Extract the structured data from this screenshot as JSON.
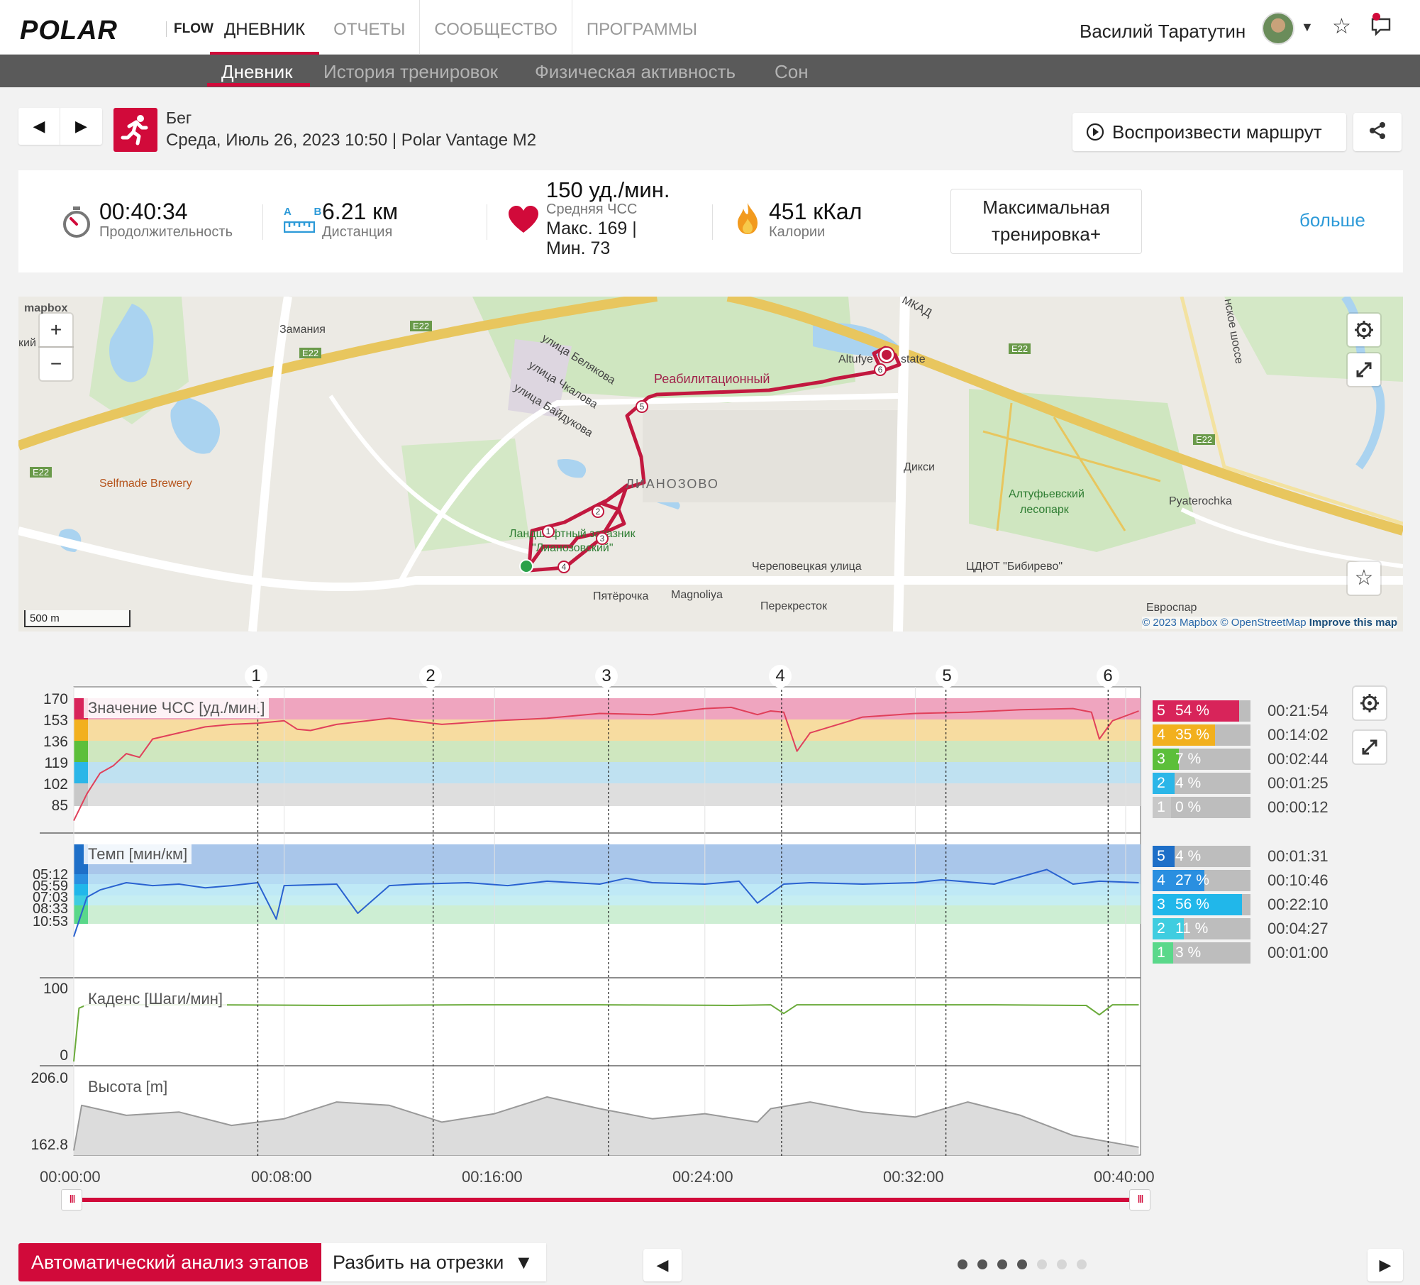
{
  "topnav": {
    "logo": "POLAR",
    "app": "FLOW",
    "items": [
      "ДНЕВНИК",
      "ОТЧЕТЫ",
      "СООБЩЕСТВО",
      "ПРОГРАММЫ"
    ],
    "active": "ДНЕВНИК",
    "user_name": "Василий Таратутин",
    "icons": [
      "avatar",
      "chevron-down-icon",
      "star-icon",
      "notifications-icon"
    ]
  },
  "subnav": {
    "items": [
      "Дневник",
      "История тренировок",
      "Физическая активность",
      "Сон"
    ],
    "active": "Дневник"
  },
  "session": {
    "sport": "Бег",
    "date_device": "Среда, Июль 26, 2023 10:50 | Polar Vantage M2",
    "replay_label": "Воспроизвести маршрут",
    "prev": "◀",
    "next": "▶"
  },
  "stats": {
    "duration_value": "00:40:34",
    "duration_label": "Продолжительность",
    "distance_value": "6.21 км",
    "distance_label": "Дистанция",
    "distance_ab": "A B",
    "hr_value": "150 уд./мин.",
    "hr_label": "Средняя ЧСС",
    "hr_max": "Макс. 169  |",
    "hr_min": "Мин. 73",
    "calories_value": "451 кКал",
    "calories_label": "Калории",
    "benefit_label": "Максимальная тренировка+",
    "more_label": "больше"
  },
  "map": {
    "brand": "mapbox",
    "labels": {
      "zamaniya": "Замания",
      "selfmade": "Selfmade Brewery",
      "rehab": "Реабилитационный",
      "altufye": "Altufye",
      "state": "state",
      "ulitsa_belyakova": "улица Белякова",
      "ulitsa_chkalova": "улица Чкалова",
      "ulitsa_baydukova": "улица Байдукова",
      "lianozovo": "ЛИАНОЗОВО",
      "lianozovo_park": "Ландшафтный заказник",
      "lianozovo_park2": "\"Лианозовский\"",
      "dixy": "Дикси",
      "forest": "Алтуфьевский",
      "forest2": "лесопарк",
      "pyaterochka_en": "Pyaterochka",
      "cherepovetskaya": "Череповецкая улица",
      "tsdyut": "ЦДЮТ \"Бибирево\"",
      "pyaterochka": "Пятёрочка",
      "magnoliya": "Magnoliya",
      "perekrestok": "Перекресток",
      "mkad": "МКАД",
      "road_e22": "E22",
      "shosse": "нское шоссе",
      "kiy": "кий",
      "sse": "ссе",
      "evrospar": "Евроспар"
    },
    "scale": "500 m",
    "zoom_in": "+",
    "zoom_out": "−",
    "attribution_mapbox": "© 2023 Mapbox",
    "attribution_osm": "© OpenStreetMap",
    "attribution_improve": "Improve this map",
    "lap_markers": [
      "1",
      "2",
      "3",
      "4",
      "5",
      "6"
    ],
    "icons": [
      "settings-icon",
      "expand-icon",
      "star-icon"
    ]
  },
  "chart_data": {
    "type": "line",
    "x_ticks": [
      "00:00:00",
      "00:08:00",
      "00:16:00",
      "00:24:00",
      "00:32:00",
      "00:40:00"
    ],
    "xlim_seconds": [
      0,
      2434
    ],
    "lap_markers": [
      {
        "label": "1",
        "time": "00:07:00"
      },
      {
        "label": "2",
        "time": "00:13:40"
      },
      {
        "label": "3",
        "time": "00:20:20"
      },
      {
        "label": "4",
        "time": "00:26:55"
      },
      {
        "label": "5",
        "time": "00:33:10"
      },
      {
        "label": "6",
        "time": "00:39:20"
      }
    ],
    "panels": [
      {
        "name": "Значение ЧСС [уд./мин.]",
        "y_ticks": [
          "170",
          "153",
          "136",
          "119",
          "102",
          "85"
        ],
        "ylim": [
          68,
          170
        ],
        "color": "#e0405a",
        "x_minutes": [
          0,
          0.5,
          1,
          1.5,
          2,
          2.5,
          3,
          4,
          5,
          6,
          7,
          8,
          8.5,
          9,
          10,
          12,
          14,
          16,
          18,
          20,
          22,
          24,
          25,
          26,
          26.5,
          27,
          27.5,
          28,
          30,
          32,
          34,
          36,
          38,
          38.7,
          39,
          39.5,
          40.5
        ],
        "values": [
          73,
          95,
          112,
          118,
          128,
          125,
          140,
          145,
          150,
          152,
          153,
          155,
          148,
          147,
          152,
          157,
          152,
          155,
          157,
          161,
          160,
          165,
          166,
          160,
          163,
          162,
          130,
          145,
          158,
          161,
          162,
          164,
          165,
          162,
          140,
          155,
          163
        ]
      },
      {
        "name": "Темп [мин/км]",
        "y_ticks": [
          "05:12",
          "05:59",
          "07:03",
          "08:33",
          "10:53"
        ],
        "color": "#2a62d0",
        "x_minutes": [
          0,
          0.5,
          1,
          2,
          3,
          4,
          5,
          6,
          7,
          7.7,
          8,
          10,
          10.8,
          12,
          13,
          15,
          16.5,
          18,
          20,
          21,
          22,
          24,
          25.3,
          26,
          27,
          28,
          30,
          32,
          33,
          35,
          37,
          38,
          39,
          40.5
        ],
        "values": [
          "12:30",
          "08:00",
          "07:10",
          "06:20",
          "06:40",
          "06:30",
          "06:55",
          "06:40",
          "06:20",
          "10:30",
          "06:40",
          "06:30",
          "09:50",
          "06:40",
          "06:30",
          "06:20",
          "06:40",
          "06:10",
          "06:30",
          "05:50",
          "06:20",
          "06:30",
          "06:10",
          "08:40",
          "06:30",
          "06:20",
          "06:30",
          "06:20",
          "06:00",
          "06:30",
          "04:50",
          "06:30",
          "06:10",
          "06:20"
        ]
      },
      {
        "name": "Каденс [Шаги/мин]",
        "y_ticks": [
          "100",
          "0"
        ],
        "ylim": [
          0,
          100
        ],
        "color": "#6aaa3a",
        "x_minutes": [
          0,
          0.2,
          0.5,
          5,
          10,
          15,
          20,
          25,
          26.5,
          27,
          27.5,
          30,
          35,
          38.5,
          39,
          39.5,
          40.5
        ],
        "values": [
          0,
          80,
          85,
          85,
          84,
          85,
          85,
          84,
          85,
          72,
          85,
          85,
          85,
          84,
          70,
          85,
          85
        ]
      },
      {
        "name": "Высота [m]",
        "y_ticks": [
          "206.0",
          "162.8"
        ],
        "ylim": [
          162.8,
          206.0
        ],
        "color": "#999999",
        "x_minutes": [
          0,
          0.3,
          2,
          4,
          6,
          8,
          10,
          12,
          14,
          16,
          18,
          20,
          22,
          24,
          26,
          26.5,
          28,
          30,
          32,
          34,
          36,
          38,
          40.5
        ],
        "values": [
          163,
          190,
          184,
          186,
          178,
          182,
          192,
          190,
          180,
          185,
          195,
          188,
          182,
          185,
          180,
          188,
          192,
          186,
          183,
          192,
          184,
          172,
          165
        ]
      }
    ],
    "hr_zones": [
      {
        "zone": "5",
        "percent": "54 %",
        "fraction": 0.54,
        "time": "00:21:54",
        "color": "#d8245a"
      },
      {
        "zone": "4",
        "percent": "35 %",
        "fraction": 0.35,
        "time": "00:14:02",
        "color": "#f2b01e"
      },
      {
        "zone": "3",
        "percent": "7 %",
        "fraction": 0.07,
        "time": "00:02:44",
        "color": "#5cbf3a"
      },
      {
        "zone": "2",
        "percent": "4 %",
        "fraction": 0.04,
        "time": "00:01:25",
        "color": "#2bb6e8"
      },
      {
        "zone": "1",
        "percent": "0 %",
        "fraction": 0.0,
        "time": "00:00:12",
        "color": "#c8c8c8"
      }
    ],
    "pace_zones": [
      {
        "zone": "5",
        "percent": "4 %",
        "fraction": 0.04,
        "time": "00:01:31",
        "color": "#1e6fc8"
      },
      {
        "zone": "4",
        "percent": "27 %",
        "fraction": 0.27,
        "time": "00:10:46",
        "color": "#2a8fe0"
      },
      {
        "zone": "3",
        "percent": "56 %",
        "fraction": 0.56,
        "time": "00:22:10",
        "color": "#21b7ea"
      },
      {
        "zone": "2",
        "percent": "11 %",
        "fraction": 0.11,
        "time": "00:04:27",
        "color": "#3fcde0"
      },
      {
        "zone": "1",
        "percent": "3 %",
        "fraction": 0.03,
        "time": "00:01:00",
        "color": "#5ad88a"
      }
    ]
  },
  "bottom": {
    "auto_laps": "Автоматический анализ этапов",
    "split": "Разбить на отрезки",
    "split_caret": "▼",
    "prev": "◀",
    "next": "▶",
    "pages": 7,
    "active_pages": 4
  }
}
